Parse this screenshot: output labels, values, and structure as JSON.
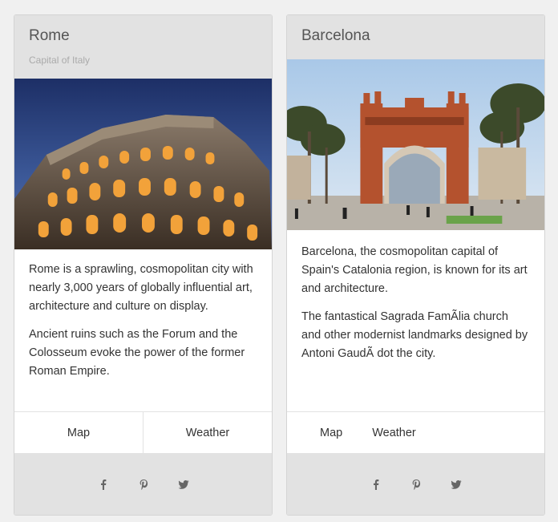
{
  "cards": [
    {
      "title": "Rome",
      "subtitle": "Capital of Italy",
      "paragraphs": [
        "Rome is a sprawling, cosmopolitan city with nearly 3,000 years of globally influential art, architecture and culture on display.",
        "Ancient ruins such as the Forum and the Colosseum evoke the power of the former Roman Empire."
      ],
      "actions": {
        "map": "Map",
        "weather": "Weather"
      },
      "image": "colosseum-photo",
      "social": [
        "facebook-icon",
        "pinterest-icon",
        "twitter-icon"
      ]
    },
    {
      "title": "Barcelona",
      "paragraphs": [
        "Barcelona, the cosmopolitan capital of Spain's Catalonia region, is known for its art and architecture.",
        "The fantastical Sagrada FamÃlia church and other modernist landmarks designed by Antoni GaudÃ dot the city."
      ],
      "actions": {
        "map": "Map",
        "weather": "Weather"
      },
      "image": "arc-de-triomf-photo",
      "social": [
        "facebook-icon",
        "pinterest-icon",
        "twitter-icon"
      ]
    }
  ],
  "colors": {
    "header_bg": "#e2e2e2",
    "page_bg": "#f0f0f0",
    "text": "#333333",
    "subtitle": "#aaaaaa",
    "icon": "#666666"
  }
}
